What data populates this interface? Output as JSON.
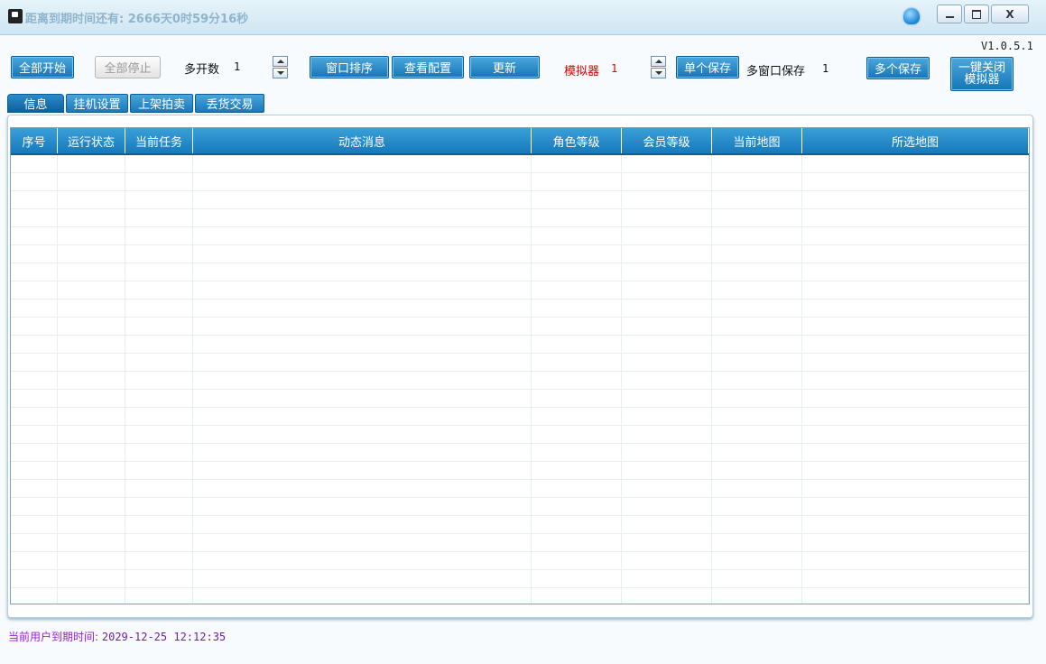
{
  "window": {
    "title": "距离到期时间还有: 2666天0时59分16秒",
    "icons": [
      "app-icon",
      "skin-icon",
      "minimize-icon",
      "maximize-icon",
      "close-icon"
    ],
    "close_glyph": "X"
  },
  "version": "V1.0.5.1",
  "toolbar": {
    "start_all": "全部开始",
    "stop_all": "全部停止",
    "multi_open_label": "多开数",
    "multi_open_value": "1",
    "arrange_windows": "窗口排序",
    "view_config": "查看配置",
    "update": "更新",
    "emulator_label": "模拟器",
    "emulator_value": "1",
    "single_save": "单个保存",
    "multi_window_save_label": "多窗口保存",
    "multi_window_save_value": "1",
    "multi_save": "多个保存",
    "close_emulator_line1": "一键关闭",
    "close_emulator_line2": "模拟器"
  },
  "tabs": [
    {
      "label": "信息",
      "active": true
    },
    {
      "label": "挂机设置",
      "active": false
    },
    {
      "label": "上架拍卖",
      "active": false
    },
    {
      "label": "丢货交易",
      "active": false
    }
  ],
  "table": {
    "columns": [
      "序号",
      "运行状态",
      "当前任务",
      "动态消息",
      "角色等级",
      "会员等级",
      "当前地图",
      "所选地图"
    ],
    "rows": []
  },
  "footer": {
    "label": "当前用户到期时间:",
    "value": "2029-12-25 12:12:35"
  },
  "colors": {
    "accent": "#1b77b8",
    "footer_text": "#9b1fd6",
    "emulator_red": "#e00000"
  }
}
